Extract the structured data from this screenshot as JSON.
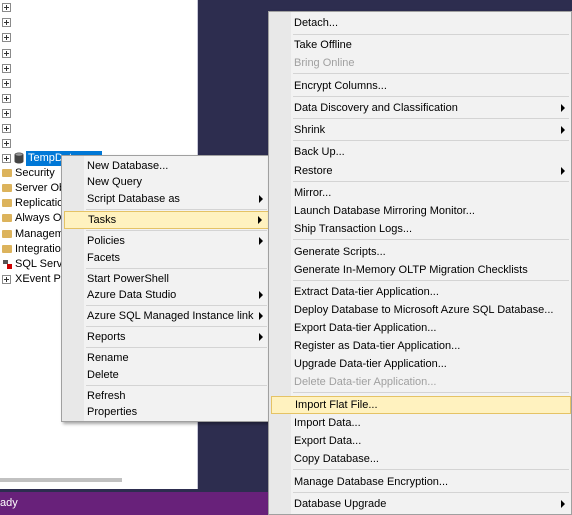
{
  "explorer": {
    "selected_node": "TempDat...",
    "tree_items": [
      "Security",
      "Server Ob",
      "Replicatio",
      "Always On",
      "Managem",
      "Integratio",
      "SQL Serve",
      "XEvent Pr"
    ]
  },
  "status": {
    "text": "ady"
  },
  "db_menu": {
    "items": [
      "New Database...",
      "New Query",
      "Script Database as",
      "Tasks",
      "Policies",
      "Facets",
      "Start PowerShell",
      "Azure Data Studio",
      "Azure SQL Managed Instance link",
      "Reports",
      "Rename",
      "Delete",
      "Refresh",
      "Properties"
    ],
    "highlighted": "Tasks"
  },
  "tasks_menu": {
    "items": [
      "Detach...",
      "Take Offline",
      "Bring Online",
      "Encrypt Columns...",
      "Data Discovery and Classification",
      "Shrink",
      "Back Up...",
      "Restore",
      "Mirror...",
      "Launch Database Mirroring Monitor...",
      "Ship Transaction Logs...",
      "Generate Scripts...",
      "Generate In-Memory OLTP Migration Checklists",
      "Extract Data-tier Application...",
      "Deploy Database to Microsoft Azure SQL Database...",
      "Export Data-tier Application...",
      "Register as Data-tier Application...",
      "Upgrade Data-tier Application...",
      "Delete Data-tier Application...",
      "Import Flat File...",
      "Import Data...",
      "Export Data...",
      "Copy Database...",
      "Manage Database Encryption...",
      "Database Upgrade"
    ],
    "highlighted": "Import Flat File...",
    "disabled": [
      "Bring Online",
      "Delete Data-tier Application..."
    ]
  },
  "colors": {
    "status_bar": "#68217a",
    "selection": "#0078d7",
    "menu_highlight": "#fff2bf"
  }
}
